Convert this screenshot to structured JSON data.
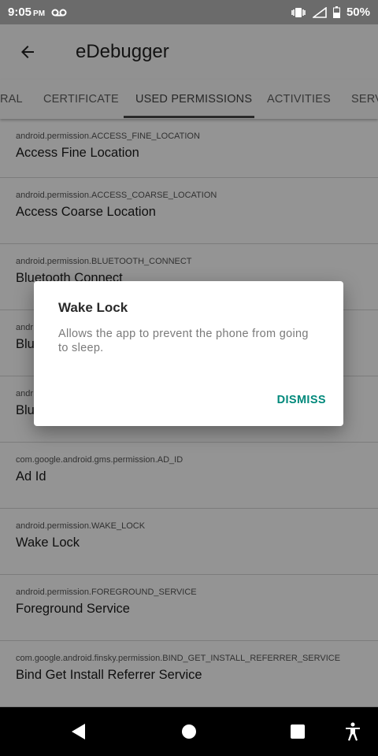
{
  "status_bar": {
    "time": "9:05",
    "ampm": "PM",
    "battery": "50%"
  },
  "app_bar": {
    "title": "eDebugger"
  },
  "tabs": [
    {
      "label": "RAL",
      "active": false
    },
    {
      "label": "CERTIFICATE",
      "active": false
    },
    {
      "label": "USED PERMISSIONS",
      "active": true
    },
    {
      "label": "ACTIVITIES",
      "active": false
    },
    {
      "label": "SERV",
      "active": false
    }
  ],
  "permissions": [
    {
      "perm": "android.permission.ACCESS_FINE_LOCATION",
      "name": "Access Fine Location"
    },
    {
      "perm": "android.permission.ACCESS_COARSE_LOCATION",
      "name": "Access Coarse Location"
    },
    {
      "perm": "android.permission.BLUETOOTH_CONNECT",
      "name": "Bluetooth Connect"
    },
    {
      "perm": "andr",
      "name": "Blu"
    },
    {
      "perm": "andr",
      "name": "Blu"
    },
    {
      "perm": "com.google.android.gms.permission.AD_ID",
      "name": "Ad Id"
    },
    {
      "perm": "android.permission.WAKE_LOCK",
      "name": "Wake Lock"
    },
    {
      "perm": "android.permission.FOREGROUND_SERVICE",
      "name": "Foreground Service"
    },
    {
      "perm": "com.google.android.finsky.permission.BIND_GET_INSTALL_REFERRER_SERVICE",
      "name": "Bind Get Install Referrer Service"
    }
  ],
  "dialog": {
    "title": "Wake Lock",
    "message": "Allows the app to prevent the phone from going to sleep.",
    "action": "DISMISS"
  },
  "colors": {
    "accent": "#00897b",
    "status_bar": "#6b6b6b",
    "nav_bar": "#000000"
  }
}
